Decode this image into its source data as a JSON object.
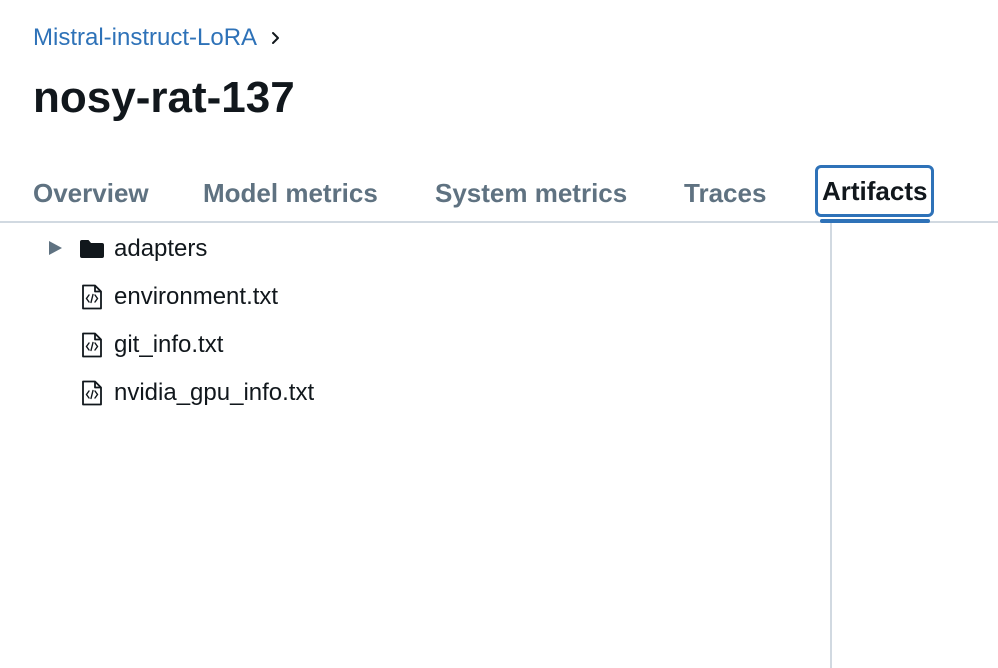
{
  "breadcrumb": {
    "experiment_name": "Mistral-instruct-LoRA",
    "separator_icon": "chevron-right-icon"
  },
  "run": {
    "name": "nosy-rat-137"
  },
  "tabs": [
    {
      "label": "Overview",
      "active": false
    },
    {
      "label": "Model metrics",
      "active": false
    },
    {
      "label": "System metrics",
      "active": false
    },
    {
      "label": "Traces",
      "active": false
    },
    {
      "label": "Artifacts",
      "active": true
    }
  ],
  "artifacts": {
    "items": [
      {
        "name": "adapters",
        "type": "folder",
        "icon": "folder-icon",
        "expanded": false
      },
      {
        "name": "environment.txt",
        "type": "file",
        "icon": "code-file-icon"
      },
      {
        "name": "git_info.txt",
        "type": "file",
        "icon": "code-file-icon"
      },
      {
        "name": "nvidia_gpu_info.txt",
        "type": "file",
        "icon": "code-file-icon"
      }
    ]
  },
  "colors": {
    "link": "#2e72b8",
    "accent": "#2e72b8",
    "text": "#11171c",
    "muted": "#5f7281",
    "border": "#d1d9e1"
  }
}
